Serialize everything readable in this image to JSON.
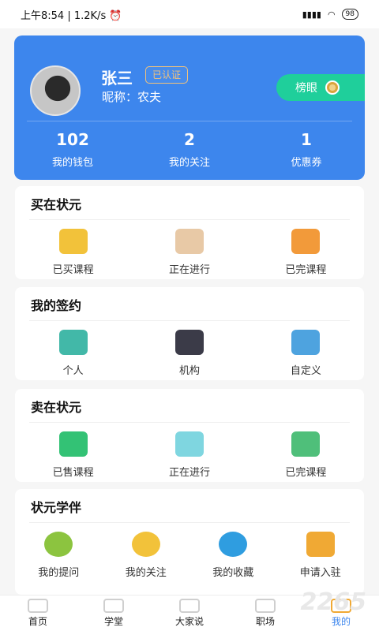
{
  "status": {
    "time": "上午8:54",
    "speed": "1.2K/s",
    "battery": "98"
  },
  "profile": {
    "name": "张三",
    "verified": "已认证",
    "nickname": "昵称：农夫",
    "rank_label": "榜眼",
    "stats": [
      {
        "value": "102",
        "label": "我的钱包"
      },
      {
        "value": "2",
        "label": "我的关注"
      },
      {
        "value": "1",
        "label": "优惠券"
      }
    ]
  },
  "sections": {
    "buy": {
      "title": "买在状元",
      "items": [
        {
          "label": "已买课程",
          "icon": "bought-course-icon",
          "color": "#f2c23a"
        },
        {
          "label": "正在进行",
          "icon": "in-progress-scroll-icon",
          "color": "#e8c9a6"
        },
        {
          "label": "已完课程",
          "icon": "books-icon",
          "color": "#f29a3a"
        }
      ]
    },
    "sign": {
      "title": "我的签约",
      "items": [
        {
          "label": "个人",
          "icon": "person-icon",
          "color": "#42b8a8"
        },
        {
          "label": "机构",
          "icon": "institution-icon",
          "color": "#3b3b48"
        },
        {
          "label": "自定义",
          "icon": "custom-icon",
          "color": "#4ea3df"
        }
      ]
    },
    "sell": {
      "title": "卖在状元",
      "items": [
        {
          "label": "已售课程",
          "icon": "sold-course-icon",
          "color": "#33c275"
        },
        {
          "label": "正在进行",
          "icon": "clipboard-icon",
          "color": "#7fd6e0"
        },
        {
          "label": "已完课程",
          "icon": "books-green-icon",
          "color": "#4fbf7a"
        }
      ]
    },
    "partner": {
      "title": "状元学伴",
      "items": [
        {
          "label": "我的提问",
          "icon": "question-icon",
          "color": "#8cc43f"
        },
        {
          "label": "我的关注",
          "icon": "follow-star-icon",
          "color": "#f2c23a"
        },
        {
          "label": "我的收藏",
          "icon": "heart-icon",
          "color": "#2f9de0"
        },
        {
          "label": "申请入驻",
          "icon": "flag-icon",
          "color": "#f0a934"
        }
      ]
    }
  },
  "tabs": [
    {
      "label": "首页"
    },
    {
      "label": "学堂"
    },
    {
      "label": "大家说"
    },
    {
      "label": "职场"
    },
    {
      "label": "我的"
    }
  ],
  "watermark": "2265"
}
